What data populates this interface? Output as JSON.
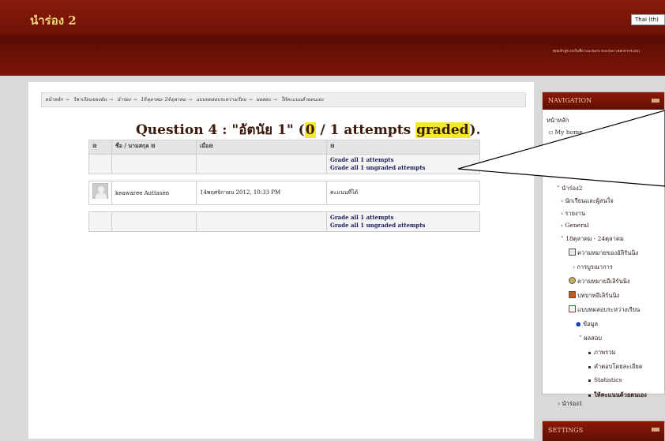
{
  "header": {
    "site_title": "นำร่อง 2",
    "language": "Thai (th)",
    "login_info": "คุณเข้าสู่ระบบในชื่อ teachers teacher (ออกจากระบบ)"
  },
  "breadcrumb": [
    "หน้าหลัก",
    "วิชาเรียนของฉัน",
    "นำร่อง",
    "18ตุลาคม- 24ตุลาคม",
    "แบบทดสอบระหว่างเรียน",
    "ผลสอบ",
    "ให้คะแนนด้วยตนเอง"
  ],
  "question": {
    "prefix": "Question 4 : \"อัตนัย 1\" (",
    "graded_count": "0",
    "middle": " / 1 attempts ",
    "graded_word": "graded",
    "suffix": ")."
  },
  "table": {
    "headers": [
      "ชื่อ / นามสกุล",
      "เมื่อ",
      ""
    ],
    "grade_all_label": "Grade all 1 attempts",
    "grade_ungraded_label": "Grade all 1 ungraded attempts",
    "row": {
      "name": "keawaree Auttasen",
      "date": "14พฤศจิกายน 2012, 10:33 PM",
      "action": "คะแนนที่ได้"
    }
  },
  "navigation": {
    "title": "NAVIGATION",
    "items": [
      "หน้าหลัก",
      "My home",
      "นำร่อง2",
      "นักเรียนและผู้สนใจ",
      "รายงาน",
      "General",
      "18ตุลาคม - 24ตุลาคม",
      "ความหมายของอัลิรันนิง",
      "การบูรณาการ",
      "ความหมายอีเลิร์นนิง",
      "บทบาทอีเลิร์นนิง",
      "แบบทดสอบระหว่างเรียน",
      "ข้อมูล",
      "ผลสอบ",
      "ภาพรวม",
      "คำตอบโดยละเอียด",
      "Statistics",
      "ให้คะแนนด้วยตนเอง",
      "นำร่อง1"
    ]
  },
  "settings": {
    "title": "SETTINGS"
  },
  "colors": {
    "header_dark": "#6e1206",
    "highlight": "#f2ea2a",
    "link": "#1b1b5c",
    "title_gold": "#f4d27a"
  }
}
